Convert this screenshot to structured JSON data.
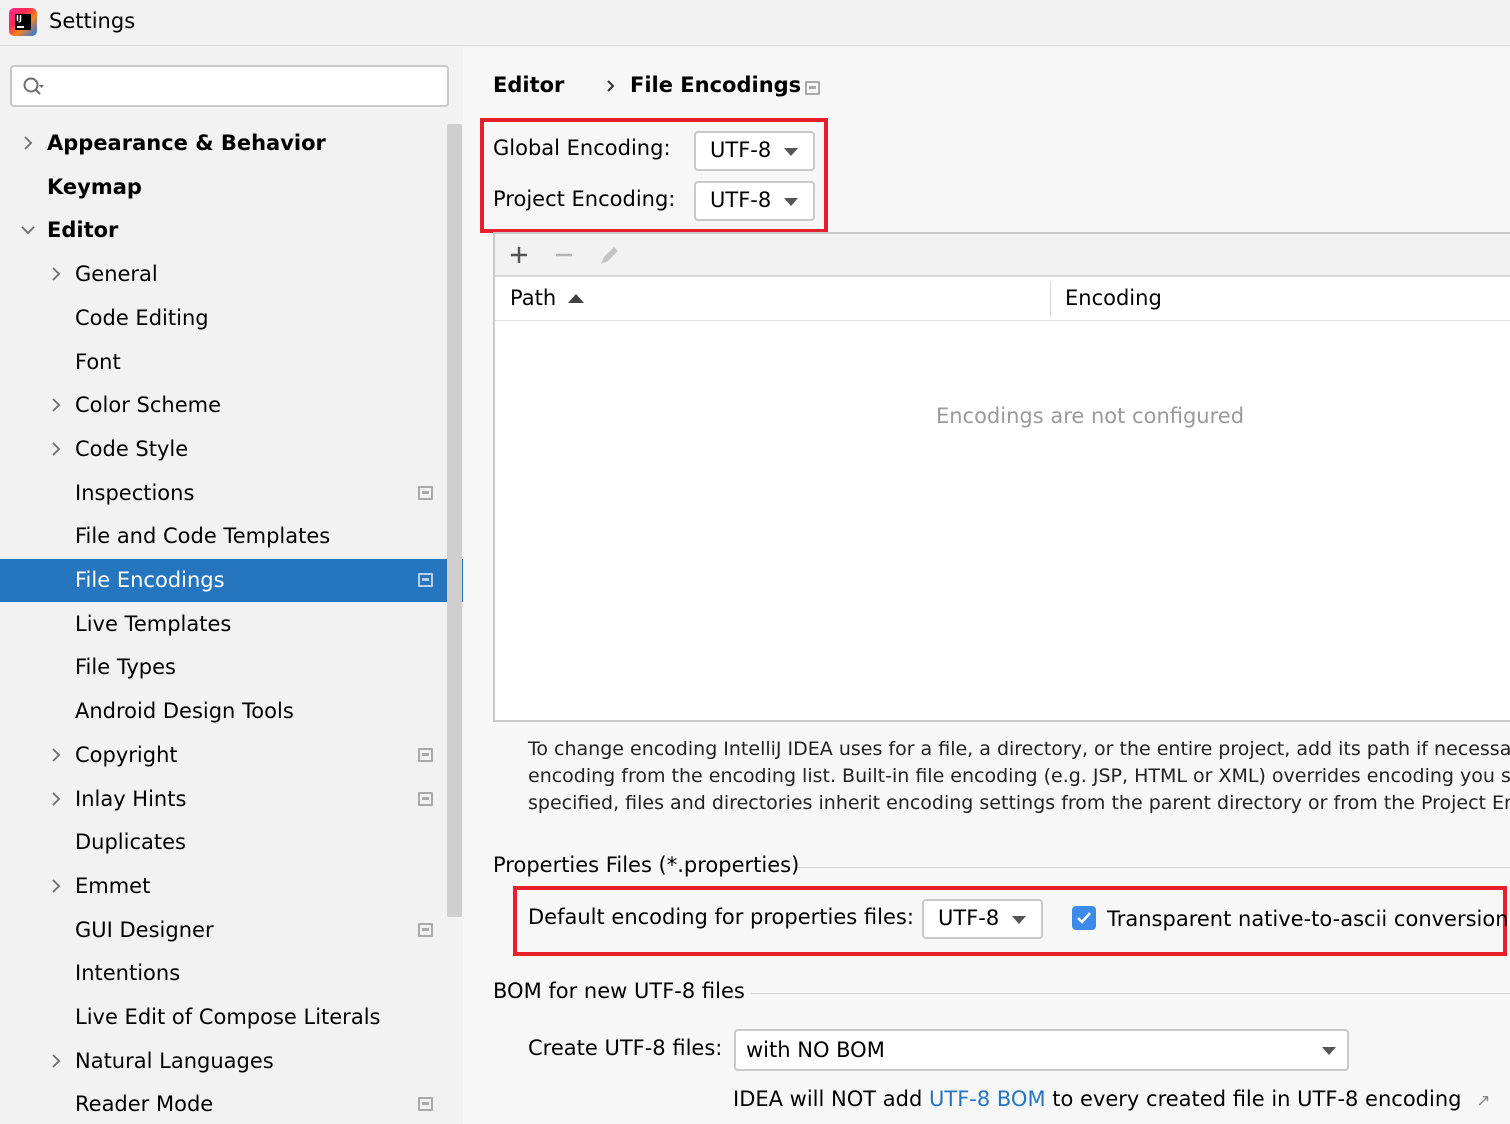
{
  "window": {
    "title": "Settings"
  },
  "sidebar": {
    "search_placeholder": "",
    "items": [
      {
        "label": "Appearance & Behavior",
        "bold": true,
        "level": 0,
        "arrow": "right",
        "project": false,
        "selected": false
      },
      {
        "label": "Keymap",
        "bold": true,
        "level": 0,
        "arrow": "none",
        "project": false,
        "selected": false
      },
      {
        "label": "Editor",
        "bold": true,
        "level": 0,
        "arrow": "down",
        "project": false,
        "selected": false
      },
      {
        "label": "General",
        "bold": false,
        "level": 1,
        "arrow": "right",
        "project": false,
        "selected": false
      },
      {
        "label": "Code Editing",
        "bold": false,
        "level": 1,
        "arrow": "none",
        "project": false,
        "selected": false
      },
      {
        "label": "Font",
        "bold": false,
        "level": 1,
        "arrow": "none",
        "project": false,
        "selected": false
      },
      {
        "label": "Color Scheme",
        "bold": false,
        "level": 1,
        "arrow": "right",
        "project": false,
        "selected": false
      },
      {
        "label": "Code Style",
        "bold": false,
        "level": 1,
        "arrow": "right",
        "project": false,
        "selected": false
      },
      {
        "label": "Inspections",
        "bold": false,
        "level": 1,
        "arrow": "none",
        "project": true,
        "selected": false
      },
      {
        "label": "File and Code Templates",
        "bold": false,
        "level": 1,
        "arrow": "none",
        "project": false,
        "selected": false
      },
      {
        "label": "File Encodings",
        "bold": false,
        "level": 1,
        "arrow": "none",
        "project": true,
        "selected": true
      },
      {
        "label": "Live Templates",
        "bold": false,
        "level": 1,
        "arrow": "none",
        "project": false,
        "selected": false
      },
      {
        "label": "File Types",
        "bold": false,
        "level": 1,
        "arrow": "none",
        "project": false,
        "selected": false
      },
      {
        "label": "Android Design Tools",
        "bold": false,
        "level": 1,
        "arrow": "none",
        "project": false,
        "selected": false
      },
      {
        "label": "Copyright",
        "bold": false,
        "level": 1,
        "arrow": "right",
        "project": true,
        "selected": false
      },
      {
        "label": "Inlay Hints",
        "bold": false,
        "level": 1,
        "arrow": "right",
        "project": true,
        "selected": false
      },
      {
        "label": "Duplicates",
        "bold": false,
        "level": 1,
        "arrow": "none",
        "project": false,
        "selected": false
      },
      {
        "label": "Emmet",
        "bold": false,
        "level": 1,
        "arrow": "right",
        "project": false,
        "selected": false
      },
      {
        "label": "GUI Designer",
        "bold": false,
        "level": 1,
        "arrow": "none",
        "project": true,
        "selected": false
      },
      {
        "label": "Intentions",
        "bold": false,
        "level": 1,
        "arrow": "none",
        "project": false,
        "selected": false
      },
      {
        "label": "Live Edit of Compose Literals",
        "bold": false,
        "level": 1,
        "arrow": "none",
        "project": false,
        "selected": false
      },
      {
        "label": "Natural Languages",
        "bold": false,
        "level": 1,
        "arrow": "right",
        "project": false,
        "selected": false
      },
      {
        "label": "Reader Mode",
        "bold": false,
        "level": 1,
        "arrow": "none",
        "project": true,
        "selected": false
      }
    ]
  },
  "breadcrumb": {
    "parent": "Editor",
    "current": "File Encodings"
  },
  "encodings": {
    "global_label": "Global Encoding:",
    "global_value": "UTF-8",
    "project_label": "Project Encoding:",
    "project_value": "UTF-8"
  },
  "table": {
    "toolbar": {
      "add": "add-icon",
      "remove": "remove-icon",
      "edit": "edit-icon"
    },
    "columns": {
      "path": "Path",
      "encoding": "Encoding"
    },
    "empty_text": "Encodings are not configured"
  },
  "description": {
    "line1": "To change encoding IntelliJ IDEA uses for a file, a directory, or the entire project, add its path if necessary a",
    "line2": "encoding from the encoding list. Built-in file encoding (e.g. JSP, HTML or XML) overrides encoding you spe",
    "line3": "specified, files and directories inherit encoding settings from the parent directory or from the Project Enco"
  },
  "properties": {
    "section_title": "Properties Files (*.properties)",
    "default_label": "Default encoding for properties files:",
    "default_value": "UTF-8",
    "transparent_label": "Transparent native-to-ascii conversion",
    "transparent_checked": true
  },
  "bom": {
    "section_title": "BOM for new UTF-8 files",
    "create_label": "Create UTF-8 files:",
    "create_value": "with NO BOM",
    "note_prefix": "IDEA will NOT add",
    "note_link": "UTF-8 BOM",
    "note_suffix": "to every created file in UTF-8 encoding",
    "note_icon": "external-link-icon"
  },
  "colors": {
    "selection": "#2675bf",
    "highlight_box": "#e8202d",
    "checkbox": "#3d8be8",
    "link": "#2675bf"
  }
}
